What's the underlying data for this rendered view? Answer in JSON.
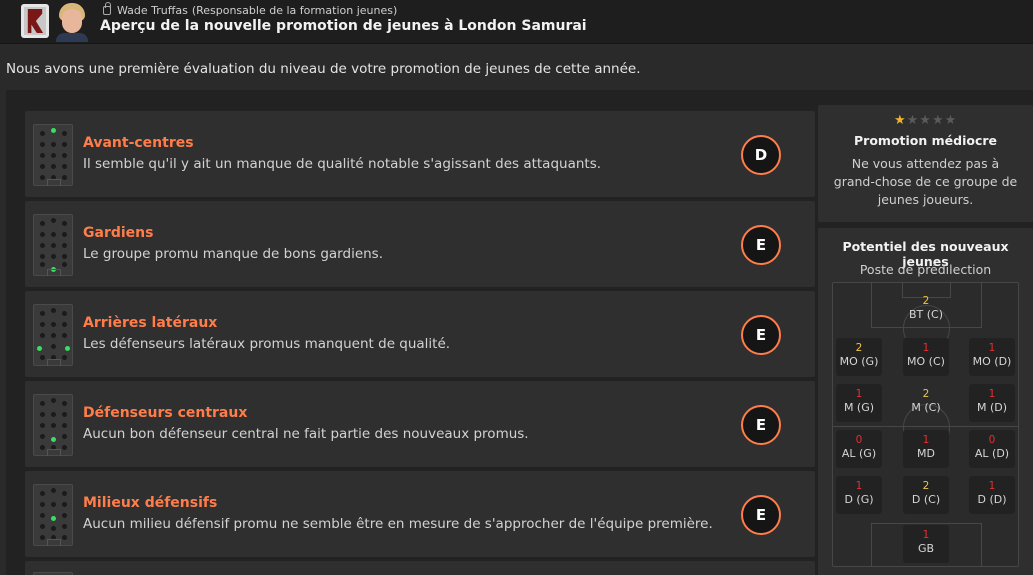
{
  "header": {
    "person_name": "Wade Truffas",
    "person_role": "(Responsable de la formation jeunes)",
    "title": "Aperçu de la nouvelle promotion de jeunes à London Samurai"
  },
  "intro": "Nous avons une première évaluation du niveau de votre promotion de jeunes de cette année.",
  "cards": [
    {
      "title": "Avant-centres",
      "desc": "Il semble qu'il y ait un manque de qualité notable s'agissant des attaquants.",
      "grade": "D"
    },
    {
      "title": "Gardiens",
      "desc": "Le groupe promu manque de bons gardiens.",
      "grade": "E"
    },
    {
      "title": "Arrières latéraux",
      "desc": "Les défenseurs latéraux promus manquent de qualité.",
      "grade": "E"
    },
    {
      "title": "Défenseurs centraux",
      "desc": "Aucun bon défenseur central ne fait partie des nouveaux promus.",
      "grade": "E"
    },
    {
      "title": "Milieux défensifs",
      "desc": "Aucun milieu défensif promu ne semble être en mesure de s'approcher de l'équipe première.",
      "grade": "E"
    }
  ],
  "summary": {
    "stars": 0.5,
    "stars_max": 5,
    "rating_title": "Promotion médiocre",
    "rating_desc": "Ne vous attendez pas à grand-chose de ce groupe de jeunes joueurs."
  },
  "potential": {
    "title": "Potentiel des nouveaux jeunes",
    "subtitle": "Poste de prédilection",
    "positions": {
      "bt_c": {
        "count": "2",
        "label": "BT (C)"
      },
      "mo_g": {
        "count": "2",
        "label": "MO (G)"
      },
      "mo_c": {
        "count": "1",
        "label": "MO (C)"
      },
      "mo_d": {
        "count": "1",
        "label": "MO (D)"
      },
      "m_g": {
        "count": "1",
        "label": "M (G)"
      },
      "m_c": {
        "count": "2",
        "label": "M (C)"
      },
      "m_d": {
        "count": "1",
        "label": "M (D)"
      },
      "al_g": {
        "count": "0",
        "label": "AL (G)"
      },
      "md": {
        "count": "1",
        "label": "MD"
      },
      "al_d": {
        "count": "0",
        "label": "AL (D)"
      },
      "d_g": {
        "count": "1",
        "label": "D (G)"
      },
      "d_c": {
        "count": "2",
        "label": "D (C)"
      },
      "d_d": {
        "count": "1",
        "label": "D (D)"
      },
      "gb": {
        "count": "1",
        "label": "GB"
      }
    }
  },
  "colors": {
    "accent": "#ff7d4a",
    "highlight_dot": "#3ddc63",
    "count_yellow": "#f0c24a",
    "count_red": "#e03030",
    "star": "#f0b429"
  }
}
